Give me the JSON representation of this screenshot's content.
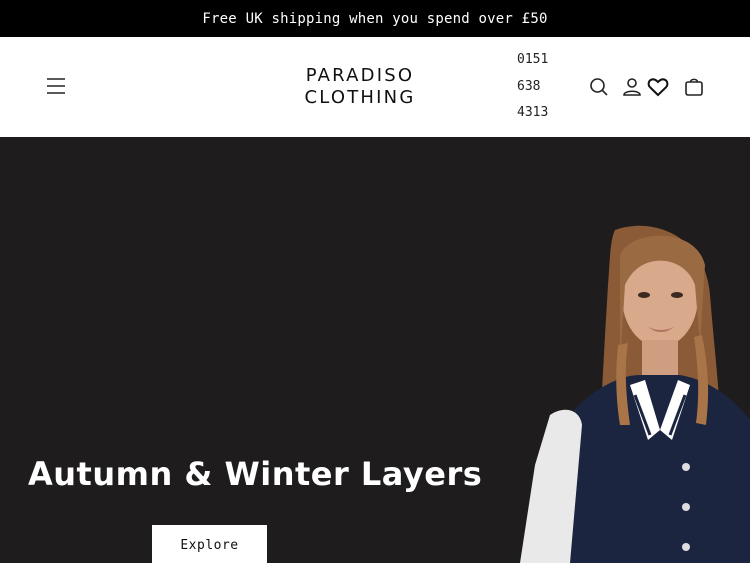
{
  "announcement": {
    "text": "Free UK shipping when you spend over £50"
  },
  "header": {
    "logo": {
      "line1": "PARADISO",
      "line2": "CLOTHING"
    },
    "phone": [
      "0151",
      "638",
      "4313"
    ],
    "icons": {
      "menu": "hamburger-menu-icon",
      "search": "search-icon",
      "account": "user-icon",
      "wishlist": "heart-icon",
      "cart": "shopping-bag-icon"
    }
  },
  "hero": {
    "title": "Autumn & Winter Layers",
    "button_label": "Explore",
    "background_color": "#1e1c1d"
  },
  "colors": {
    "announcement_bg": "#000000",
    "header_bg": "#ffffff",
    "text_dark": "#111111"
  }
}
